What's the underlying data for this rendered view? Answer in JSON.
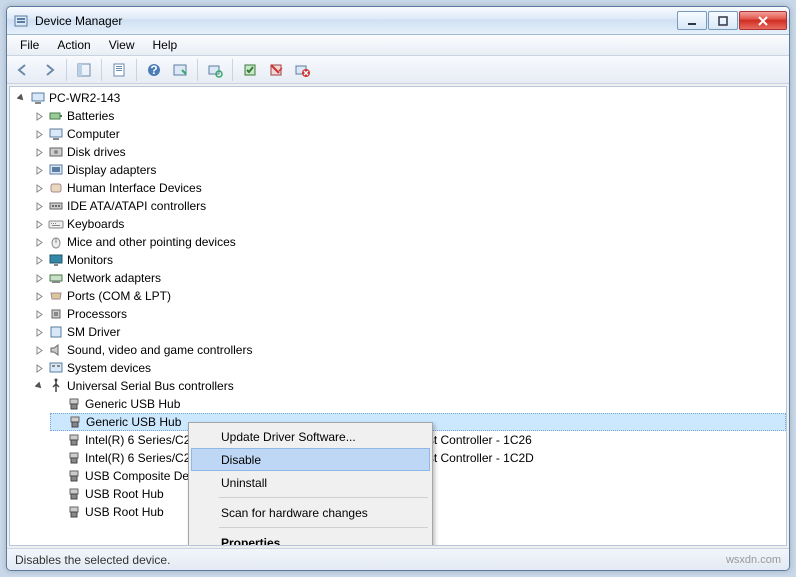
{
  "window": {
    "title": "Device Manager"
  },
  "menu": {
    "file": "File",
    "action": "Action",
    "view": "View",
    "help": "Help"
  },
  "tree": {
    "root": "PC-WR2-143",
    "categories": [
      {
        "label": "Batteries"
      },
      {
        "label": "Computer"
      },
      {
        "label": "Disk drives"
      },
      {
        "label": "Display adapters"
      },
      {
        "label": "Human Interface Devices"
      },
      {
        "label": "IDE ATA/ATAPI controllers"
      },
      {
        "label": "Keyboards"
      },
      {
        "label": "Mice and other pointing devices"
      },
      {
        "label": "Monitors"
      },
      {
        "label": "Network adapters"
      },
      {
        "label": "Ports (COM & LPT)"
      },
      {
        "label": "Processors"
      },
      {
        "label": "SM Driver"
      },
      {
        "label": "Sound, video and game controllers"
      },
      {
        "label": "System devices"
      }
    ],
    "usb": {
      "label": "Universal Serial Bus controllers",
      "items": [
        "Generic USB Hub",
        "Generic USB Hub",
        "Intel(R) 6 Series/C200 Series Chipset Family USB Enhanced Host Controller - 1C26",
        "Intel(R) 6 Series/C200 Series Chipset Family USB Enhanced Host Controller - 1C2D",
        "USB Composite Device",
        "USB Root Hub",
        "USB Root Hub"
      ]
    }
  },
  "context_menu": {
    "update": "Update Driver Software...",
    "disable": "Disable",
    "uninstall": "Uninstall",
    "scan": "Scan for hardware changes",
    "properties": "Properties"
  },
  "status": "Disables the selected device.",
  "watermark": "wsxdn.com"
}
